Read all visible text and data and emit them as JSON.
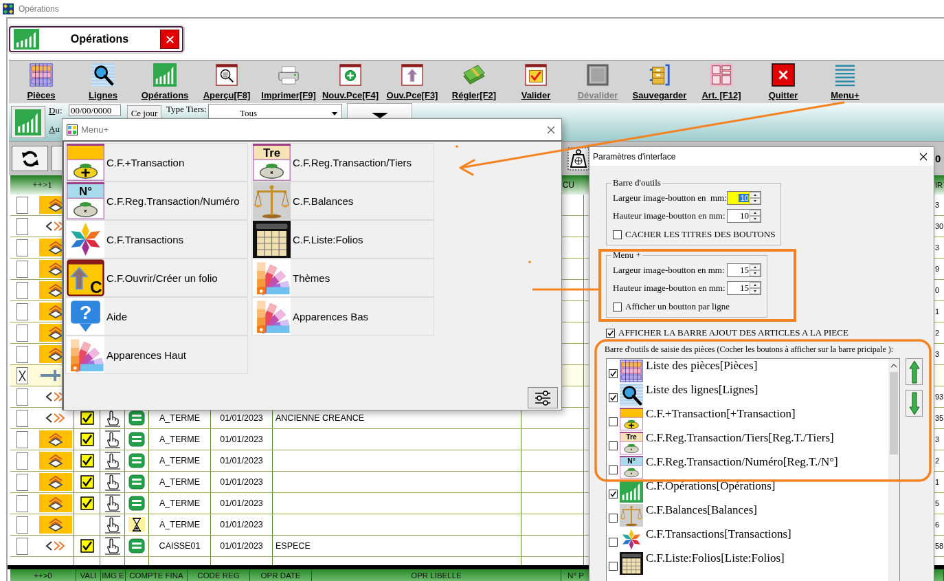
{
  "window": {
    "title": "Opérations"
  },
  "document_tab": {
    "label": "Opérations"
  },
  "toolbar": [
    {
      "label": "Pièces",
      "kind": "pieces",
      "disabled": false
    },
    {
      "label": "Lignes",
      "kind": "lines",
      "disabled": false
    },
    {
      "label": "Opérations",
      "kind": "operations",
      "disabled": false
    },
    {
      "label": "Aperçu[F8]",
      "kind": "preview",
      "disabled": false
    },
    {
      "label": "Imprimer[F9]",
      "kind": "print",
      "disabled": false
    },
    {
      "label": "Nouv.Pce[F4]",
      "kind": "new",
      "disabled": false
    },
    {
      "label": "Ouv.Pce[F3]",
      "kind": "open",
      "disabled": false
    },
    {
      "label": "Régler[F2]",
      "kind": "pay",
      "disabled": false
    },
    {
      "label": "Valider",
      "kind": "validate",
      "disabled": false
    },
    {
      "label": "Dévalider",
      "kind": "invalidate",
      "disabled": true
    },
    {
      "label": "Sauvegarder",
      "kind": "save",
      "disabled": false
    },
    {
      "label": "Art. [F12]",
      "kind": "articles",
      "disabled": false
    },
    {
      "label": "Quitter",
      "kind": "quit",
      "disabled": false
    },
    {
      "label": "Menu+",
      "kind": "menu",
      "disabled": false
    }
  ],
  "filters": {
    "from_label": "Du:",
    "from_value": "00/00/0000",
    "today_button": "Ce jour",
    "third_party_label": "Type Tiers:",
    "third_party_value": "Tous",
    "to_label": "Au"
  },
  "grid_toolbar": {
    "edge_text": "0"
  },
  "table": {
    "header": {
      "column_1": "++>1",
      "column_8": "CU",
      "column_last": "IR"
    },
    "rows": [
      {
        "kind": "tile",
        "checked": false,
        "selected": false,
        "column_last": "3"
      },
      {
        "kind": "link",
        "checked": false,
        "selected": false,
        "column_last": "30"
      },
      {
        "kind": "tile",
        "checked": false,
        "selected": false,
        "column_last": "3"
      },
      {
        "kind": "tile",
        "checked": false,
        "selected": false,
        "column_last": "9"
      },
      {
        "kind": "tile",
        "checked": false,
        "selected": false,
        "column_last": "0"
      },
      {
        "kind": "tile",
        "checked": false,
        "selected": false,
        "column_last": "1"
      },
      {
        "kind": "tile",
        "checked": false,
        "selected": false,
        "column_last": "2"
      },
      {
        "kind": "tile",
        "checked": false,
        "selected": false,
        "column_last": "3"
      },
      {
        "kind": "new",
        "checked": true,
        "selected": true
      },
      {
        "kind": "link",
        "checked": false,
        "selected": false,
        "column_last": "93"
      },
      {
        "kind": "link",
        "checked": false,
        "selected": false,
        "column_last": "35",
        "detail": {
          "valid": true,
          "pending": false,
          "account": "A_TERME",
          "date": "01/01/2023",
          "label": "ANCIENNE CREANCE"
        }
      },
      {
        "kind": "tile",
        "checked": false,
        "selected": false,
        "column_last": "3",
        "detail": {
          "valid": true,
          "pending": false,
          "account": "A_TERME",
          "date": "01/01/2023"
        }
      },
      {
        "kind": "tile",
        "checked": false,
        "selected": false,
        "column_last": "2",
        "detail": {
          "valid": true,
          "pending": false,
          "account": "A_TERME",
          "date": "01/01/2023"
        }
      },
      {
        "kind": "tile",
        "checked": false,
        "selected": false,
        "column_last": "1",
        "detail": {
          "valid": true,
          "pending": false,
          "account": "A_TERME",
          "date": "01/01/2023"
        }
      },
      {
        "kind": "tile",
        "checked": false,
        "selected": false,
        "column_last": "5",
        "detail": {
          "valid": true,
          "pending": false,
          "account": "A_TERME",
          "date": "01/01/2023"
        }
      },
      {
        "kind": "tile",
        "checked": false,
        "selected": false,
        "column_last": "6",
        "detail": {
          "valid": false,
          "pending": true,
          "account": "A_TERME",
          "date": "01/01/2023"
        }
      },
      {
        "kind": "link",
        "checked": false,
        "selected": false,
        "column_last": "58",
        "detail": {
          "valid": true,
          "pending": false,
          "account": "CAISSE01",
          "date": "01/01/2023",
          "label": "ESPECE"
        }
      }
    ]
  },
  "bottom_table": {
    "columns": [
      "++>0",
      "VALI",
      "IMG E",
      "COMPTE FINA",
      "CODE REG",
      "OPR DATE",
      "OPR LIBELLE",
      "N° P"
    ]
  },
  "menu_plus": {
    "title": "Menu+",
    "items": [
      {
        "label": "C.F.+Transaction",
        "kind": "bag_plus"
      },
      {
        "label": "C.F.Reg.Transaction/Tiers",
        "kind": "bag_tiers",
        "icon_text": "Tre"
      },
      {
        "label": "C.F.Reg.Transaction/Numéro",
        "kind": "bag_number",
        "icon_text": "N°"
      },
      {
        "label": "C.F.Balances",
        "kind": "scale"
      },
      {
        "label": "C.F.Transactions",
        "kind": "star"
      },
      {
        "label": "C.F.Liste:Folios",
        "kind": "folios"
      },
      {
        "label": "C.F.Ouvrir/Créer un folio",
        "kind": "open_folio",
        "icon_text": "C"
      },
      {
        "label": "Thèmes",
        "kind": "palette"
      },
      {
        "label": "Aide",
        "kind": "help",
        "icon_text": "?"
      },
      {
        "label": "Apparences Bas",
        "kind": "palette"
      },
      {
        "label": "Apparences Haut",
        "kind": "palette"
      }
    ]
  },
  "settings": {
    "title": "Paramètres d'interface",
    "groups": [
      {
        "legend": "Barre d'outils",
        "fields": [
          {
            "label": "Largeur image-boutton en  mm:",
            "value": "10",
            "focused": true
          },
          {
            "label": "Hauteur image-boutton en mm:",
            "value": "10",
            "focused": false
          }
        ],
        "option": {
          "label": "CACHER LES TITRES DES BOUTONS",
          "checked": false
        }
      },
      {
        "legend": "Menu +",
        "fields": [
          {
            "label": "Largeur image-boutton en mm:",
            "value": "15",
            "focused": false
          },
          {
            "label": "Hauteur image-boutton en mm:",
            "value": "15",
            "focused": false
          }
        ],
        "option": {
          "label": "Afficher un boutton par ligne",
          "checked": false
        }
      }
    ],
    "articles_bar": {
      "label": "AFFICHER LA BARRE AJOUT DES ARTICLES A LA PIECE",
      "checked": true
    },
    "buttons_list": {
      "caption": "Barre d'outils de saisie des pièces (Cocher les boutons à afficher sur la barre pricipale ):",
      "items": [
        {
          "label": "Liste des pièces[Pièces]",
          "kind": "pieces",
          "checked": true
        },
        {
          "label": "Liste des lignes[Lignes]",
          "kind": "lines",
          "checked": true
        },
        {
          "label": "C.F.+Transaction[+Transaction]",
          "kind": "bag_plus",
          "checked": false
        },
        {
          "label": "C.F.Reg.Transaction/Tiers[Reg.T./Tiers]",
          "kind": "bag_tiers",
          "icon_text": "Tre",
          "checked": false
        },
        {
          "label": "C.F.Reg.Transaction/Numéro[Reg.T./N°]",
          "kind": "bag_number",
          "icon_text": "N°",
          "checked": false
        },
        {
          "label": "C.F.Opérations[Opérations]",
          "kind": "operations",
          "checked": true
        },
        {
          "label": "C.F.Balances[Balances]",
          "kind": "scale",
          "checked": false
        },
        {
          "label": "C.F.Transactions[Transactions]",
          "kind": "star",
          "checked": false
        },
        {
          "label": "C.F.Liste:Folios[Liste:Folios]",
          "kind": "folios",
          "checked": false
        }
      ]
    }
  }
}
